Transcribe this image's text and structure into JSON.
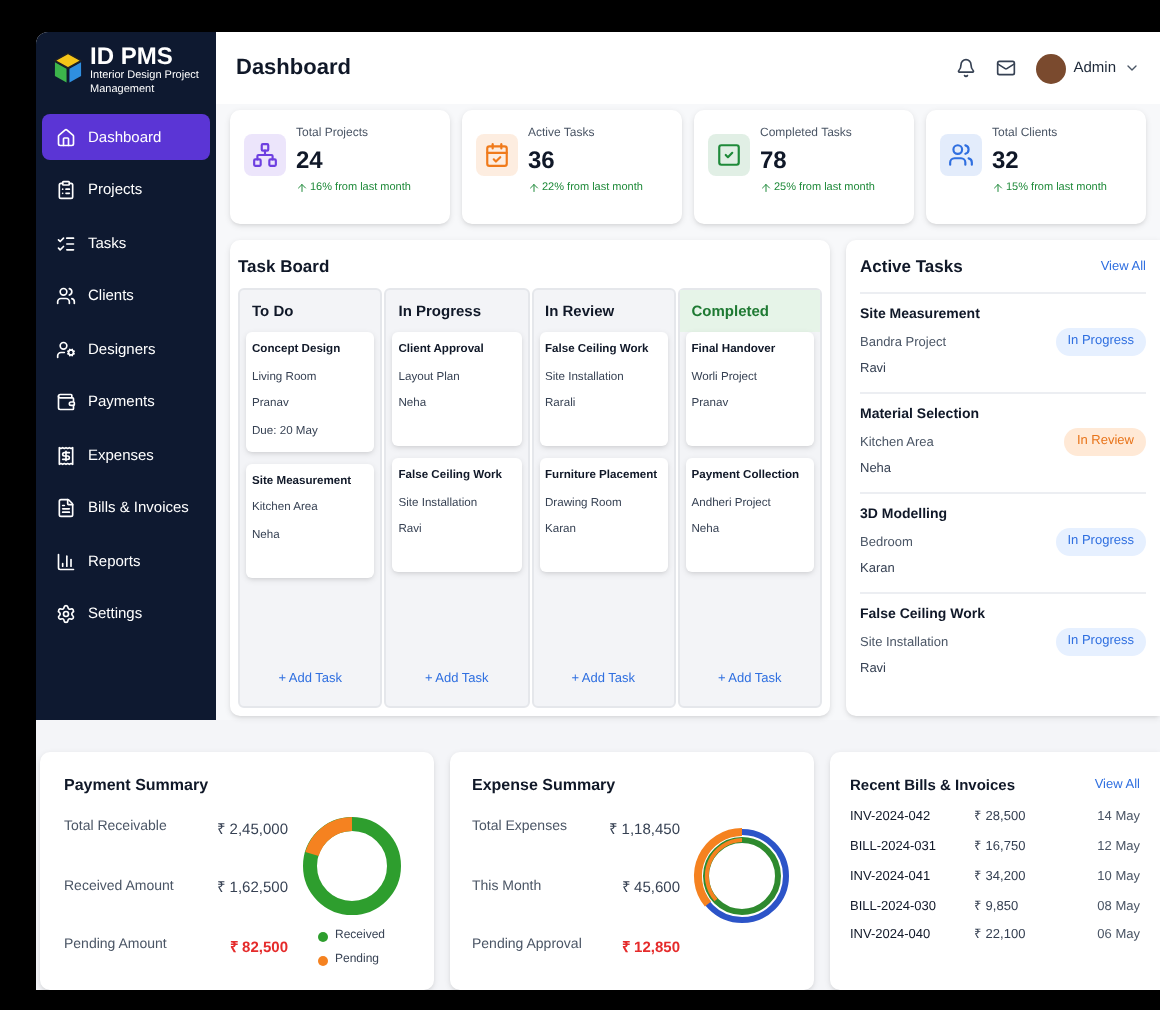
{
  "brand": {
    "name": "ID PMS",
    "subtitle": "Interior Design Project Management"
  },
  "sidebar": {
    "items": [
      {
        "label": "Dashboard",
        "selected": true
      },
      {
        "label": "Projects",
        "selected": false
      },
      {
        "label": "Tasks",
        "selected": false
      },
      {
        "label": "Clients",
        "selected": false
      },
      {
        "label": "Designers",
        "selected": false
      },
      {
        "label": "Payments",
        "selected": false
      },
      {
        "label": "Expenses",
        "selected": false
      },
      {
        "label": "Bills & Invoices",
        "selected": false
      },
      {
        "label": "Reports",
        "selected": false
      },
      {
        "label": "Settings",
        "selected": false
      }
    ]
  },
  "header": {
    "title": "Dashboard",
    "user": "Admin"
  },
  "stats": [
    {
      "label": "Total Projects",
      "value": "24",
      "delta": "16% from last month",
      "color": "#6d3fe0"
    },
    {
      "label": "Active Tasks",
      "value": "36",
      "delta": "22% from last month",
      "color": "#f07a1a"
    },
    {
      "label": "Completed Tasks",
      "value": "78",
      "delta": "25% from last month",
      "color": "#1f8a3a"
    },
    {
      "label": "Total Clients",
      "value": "32",
      "delta": "15% from last month",
      "color": "#2f6fe0"
    }
  ],
  "task_board": {
    "title": "Task Board",
    "columns": [
      {
        "name": "To Do",
        "completed": false,
        "add": "+ Add Task",
        "tasks": [
          {
            "title": "Concept Design",
            "lines": [
              "Living Room",
              "Pranav",
              "Due: 20 May"
            ]
          },
          {
            "title": "Site Measurement",
            "lines": [
              "Kitchen Area",
              "Neha"
            ]
          }
        ]
      },
      {
        "name": "In Progress",
        "completed": false,
        "add": "+ Add Task",
        "tasks": [
          {
            "title": "Client Approval",
            "lines": [
              "Layout Plan",
              "Neha"
            ]
          },
          {
            "title": "False Ceiling Work",
            "lines": [
              "Site Installation",
              "Ravi"
            ]
          }
        ]
      },
      {
        "name": "In Review",
        "completed": false,
        "add": "+ Add Task",
        "tasks": [
          {
            "title": "False Ceiling Work",
            "lines": [
              "Site Installation",
              "Rarali"
            ]
          },
          {
            "title": "Furniture Placement",
            "lines": [
              "Drawing Room",
              "Karan"
            ]
          }
        ]
      },
      {
        "name": "Completed",
        "completed": true,
        "add": "+ Add Task",
        "tasks": [
          {
            "title": "Final Handover",
            "lines": [
              "Worli Project",
              "Pranav"
            ]
          },
          {
            "title": "Payment Collection",
            "lines": [
              "Andheri Project",
              "Neha"
            ]
          }
        ]
      }
    ]
  },
  "active_tasks": {
    "title": "Active Tasks",
    "link": "View All",
    "items": [
      {
        "title": "Site Measurement",
        "project": "Bandra Project",
        "person": "Ravi",
        "status": "In Progress",
        "kind": "progress"
      },
      {
        "title": "Material Selection",
        "project": "Kitchen Area",
        "person": "Neha",
        "status": "In Review",
        "kind": "review"
      },
      {
        "title": "3D Modelling",
        "project": "Bedroom",
        "person": "Karan",
        "status": "In Progress",
        "kind": "progress"
      },
      {
        "title": "False Ceiling Work",
        "project": "Site Installation",
        "person": "Ravi",
        "status": "In Progress",
        "kind": "progress"
      }
    ]
  },
  "payment_summary": {
    "title": "Payment Summary",
    "rows": [
      {
        "label": "Total Receivable",
        "value": "₹ 2,45,000",
        "alert": false
      },
      {
        "label": "Received Amount",
        "value": "₹ 1,62,500",
        "alert": false
      },
      {
        "label": "Pending Amount",
        "value": "₹ 82,500",
        "alert": true
      }
    ],
    "legend": [
      {
        "label": "Received",
        "color": "#2e9e2e"
      },
      {
        "label": "Pending",
        "color": "#f58220"
      }
    ]
  },
  "expense_summary": {
    "title": "Expense Summary",
    "rows": [
      {
        "label": "Total Expenses",
        "value": "₹ 1,18,450",
        "alert": false
      },
      {
        "label": "This Month",
        "value": "₹ 45,600",
        "alert": false
      },
      {
        "label": "Pending Approval",
        "value": "₹ 12,850",
        "alert": true
      }
    ]
  },
  "bills": {
    "title": "Recent Bills & Invoices",
    "link": "View All",
    "rows": [
      {
        "id": "INV-2024-042",
        "amount": "₹ 28,500",
        "date": "14 May"
      },
      {
        "id": "BILL-2024-031",
        "amount": "₹ 16,750",
        "date": "12 May"
      },
      {
        "id": "INV-2024-041",
        "amount": "₹ 34,200",
        "date": "10 May"
      },
      {
        "id": "BILL-2024-030",
        "amount": "₹ 9,850",
        "date": "08 May"
      },
      {
        "id": "INV-2024-040",
        "amount": "₹ 22,100",
        "date": "06 May"
      }
    ]
  }
}
